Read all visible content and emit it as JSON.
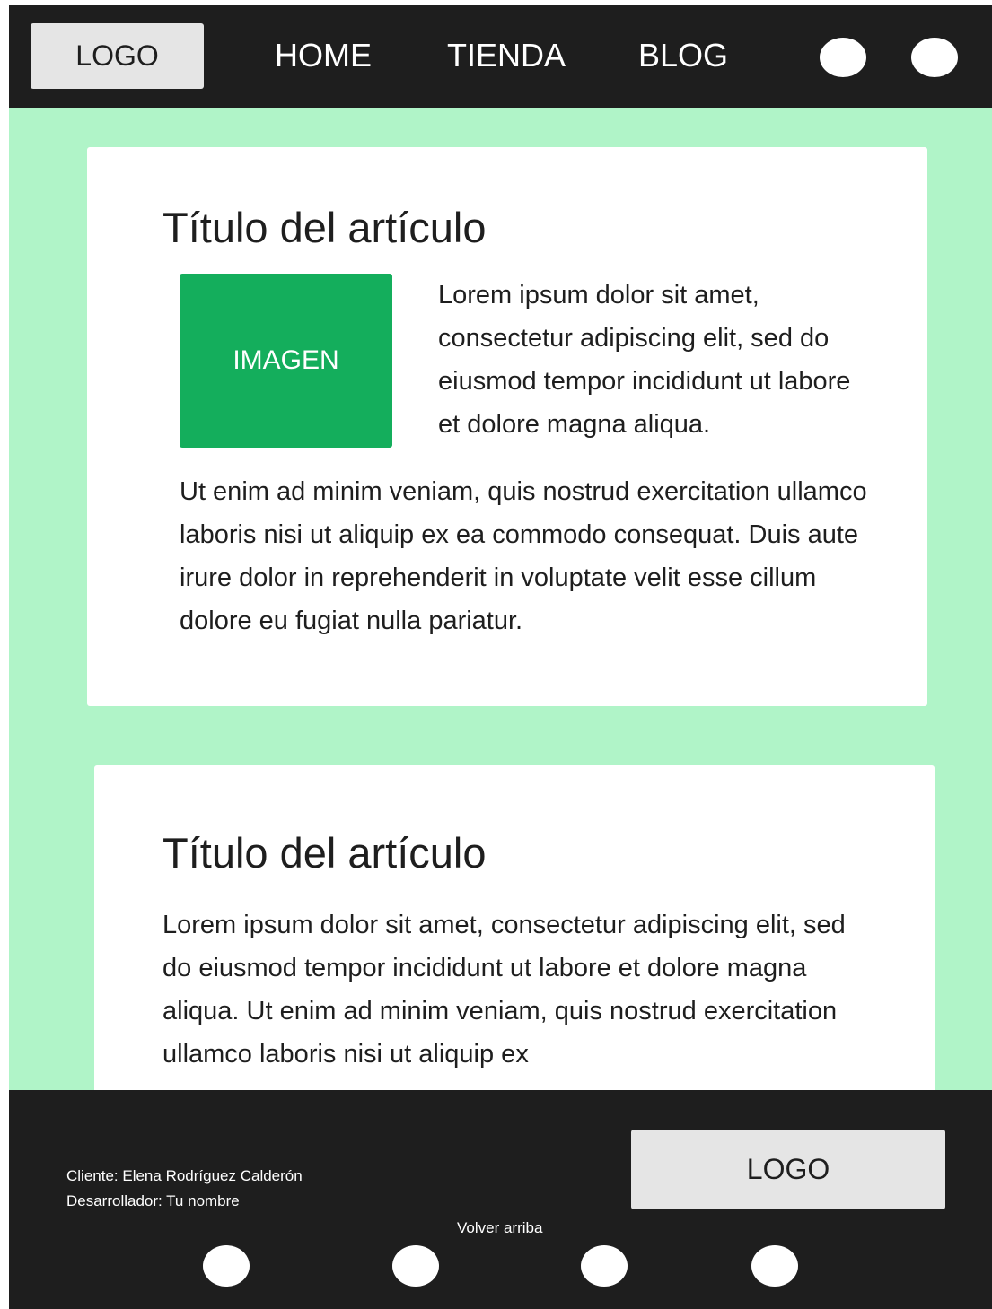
{
  "header": {
    "logo": "LOGO",
    "nav": [
      "HOME",
      "TIENDA",
      "BLOG"
    ],
    "icons": [
      "circle-icon",
      "circle-icon"
    ]
  },
  "articles": [
    {
      "title": "Título del artículo",
      "image_label": "IMAGEN",
      "intro": "Lorem ipsum dolor sit amet, consectetur adipiscing elit, sed do eiusmod tempor incididunt ut labore et dolore magna aliqua.",
      "body": "Ut enim ad minim veniam, quis nostrud exercitation ullamco laboris nisi ut aliquip ex ea commodo consequat. Duis aute irure dolor in reprehenderit in voluptate velit esse cillum dolore eu fugiat nulla pariatur."
    },
    {
      "title": "Título del artículo",
      "body": "Lorem ipsum dolor sit amet, consectetur adipiscing elit, sed do eiusmod tempor incididunt ut labore et dolore magna aliqua. Ut enim ad minim veniam, quis nostrud exercitation ullamco laboris nisi ut aliquip ex"
    }
  ],
  "footer": {
    "client": "Cliente: Elena Rodríguez Calderón",
    "developer": "Desarrollador: Tu nombre",
    "back_to_top": "Volver arriba",
    "logo": "LOGO",
    "social_icons": [
      "circle-icon",
      "circle-icon",
      "circle-icon",
      "circle-icon"
    ]
  },
  "colors": {
    "header_bg": "#1e1e1e",
    "page_bg": "#b0f4c8",
    "image_bg": "#14ae5c",
    "logo_bg": "#e5e5e5"
  }
}
